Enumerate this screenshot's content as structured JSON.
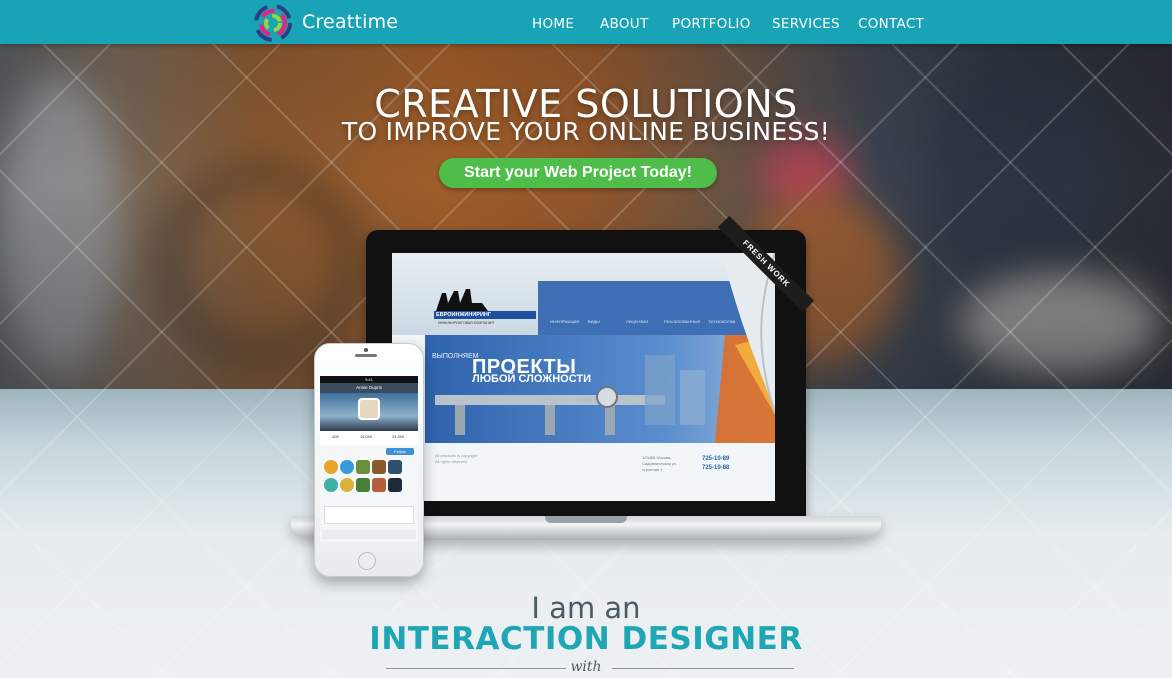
{
  "brand": {
    "name": "Creattime"
  },
  "nav": {
    "items": [
      {
        "label": "HOME"
      },
      {
        "label": "ABOUT"
      },
      {
        "label": "PORTFOLIO"
      },
      {
        "label": "SERVICES"
      },
      {
        "label": "CONTACT"
      }
    ]
  },
  "hero": {
    "headline_1": "CREATIVE SOLUTIONS",
    "headline_2": "TO IMPROVE YOUR ONLINE BUSINESS!",
    "cta_label": "Start your Web Project Today!",
    "ribbon_label": "FRESH WORK"
  },
  "laptop_site": {
    "logo_text": "ЕВРОИНЖИНИРИНГ",
    "logo_subtext": "ИНЖИНИРИНГОВАЯ КОМПАНИЯ",
    "banner_small": "ВЫПОЛНЯЕМ",
    "banner_big": "ПРОЕКТЫ",
    "banner_sub": "ЛЮБОЙ СЛОЖНОСТИ",
    "phone_1": "725-10-89",
    "phone_2": "725-10-88"
  },
  "phone_app": {
    "title": "Annie Dupris",
    "follow_label": "Follow",
    "stats": [
      "405",
      "15,000",
      "24,300"
    ]
  },
  "intro": {
    "line_1": "I am an",
    "line_2": "INTERACTION DESIGNER",
    "line_3": "with"
  },
  "colors": {
    "nav_bg": "#18a3b6",
    "cta_green": "#4fbd4a",
    "accent_teal": "#1fa6b5"
  }
}
